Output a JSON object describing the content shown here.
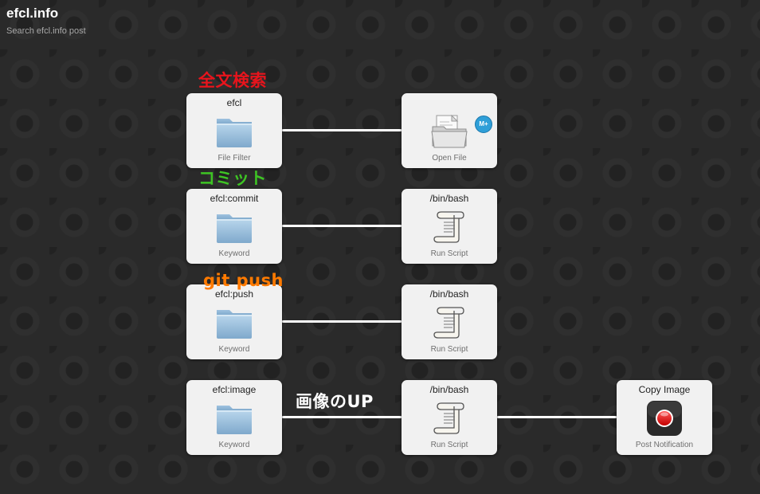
{
  "header": {
    "title": "efcl.info",
    "subtitle": "Search efcl.info post"
  },
  "colors": {
    "annotation_fulltext": "#e8141c",
    "annotation_commit": "#3ec424",
    "annotation_push": "#ff7a00",
    "annotation_image": "#ffffff"
  },
  "annotations": {
    "fulltext": "全文検索",
    "commit": "コミット",
    "push": "git push",
    "image": "画像のUP"
  },
  "nodes": {
    "file_filter": {
      "title": "efcl",
      "subtitle": "File Filter",
      "icon": "folder-icon"
    },
    "open_file": {
      "title": "",
      "subtitle": "Open File",
      "icon": "open-folder-icon",
      "badge": "M+"
    },
    "keyword_commit": {
      "title": "efcl:commit",
      "subtitle": "Keyword",
      "icon": "folder-icon"
    },
    "script_commit": {
      "title": "/bin/bash",
      "subtitle": "Run Script",
      "icon": "script-scroll-icon"
    },
    "keyword_push": {
      "title": "efcl:push",
      "subtitle": "Keyword",
      "icon": "folder-icon"
    },
    "script_push": {
      "title": "/bin/bash",
      "subtitle": "Run Script",
      "icon": "script-scroll-icon"
    },
    "keyword_image": {
      "title": "efcl:image",
      "subtitle": "Keyword",
      "icon": "folder-icon"
    },
    "script_image": {
      "title": "/bin/bash",
      "subtitle": "Run Script",
      "icon": "script-scroll-icon"
    },
    "post_notification": {
      "title": "Copy Image",
      "subtitle": "Post Notification",
      "icon": "record-button-icon"
    }
  }
}
